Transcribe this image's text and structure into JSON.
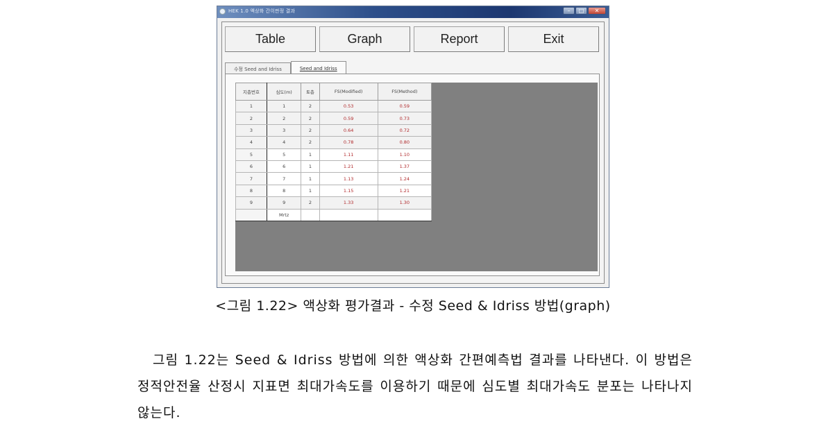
{
  "window": {
    "title": "HEK 1.0 액상화 간이판정 결과",
    "buttons": {
      "minimize": "–",
      "maximize": "□",
      "close": "✕"
    }
  },
  "toolbar": {
    "buttons": [
      "Table",
      "Graph",
      "Report",
      "Exit"
    ]
  },
  "tabs": [
    {
      "label": "수정 Seed and Idriss",
      "active": false
    },
    {
      "label": "Seed and Idriss",
      "active": true
    }
  ],
  "grid": {
    "headers": [
      "지층번호",
      "심도(m)",
      "토층",
      "FS(Modified)",
      "FS(Method)"
    ],
    "rows": [
      {
        "no": "1",
        "depth": "1",
        "soil": "2",
        "v1": "0.53",
        "v2": "0.59"
      },
      {
        "no": "2",
        "depth": "2",
        "soil": "2",
        "v1": "0.59",
        "v2": "0.73"
      },
      {
        "no": "3",
        "depth": "3",
        "soil": "2",
        "v1": "0.64",
        "v2": "0.72"
      },
      {
        "no": "4",
        "depth": "4",
        "soil": "2",
        "v1": "0.78",
        "v2": "0.80"
      },
      {
        "no": "5",
        "depth": "5",
        "soil": "1",
        "v1": "1.11",
        "v2": "1.10"
      },
      {
        "no": "6",
        "depth": "6",
        "soil": "1",
        "v1": "1.21",
        "v2": "1.37"
      },
      {
        "no": "7",
        "depth": "7",
        "soil": "1",
        "v1": "1.13",
        "v2": "1.24"
      },
      {
        "no": "8",
        "depth": "8",
        "soil": "1",
        "v1": "1.15",
        "v2": "1.21"
      },
      {
        "no": "9",
        "depth": "9",
        "soil": "2",
        "v1": "1.33",
        "v2": "1.30"
      }
    ],
    "footer": {
      "no": "",
      "depth": "Mrtz",
      "soil": "",
      "v1": "",
      "v2": ""
    }
  },
  "colors": {
    "value_red": "#b0282a",
    "pane_gray": "#808080"
  },
  "document": {
    "caption": "<그림 1.22> 액상화 평가결과 - 수정 Seed & Idriss 방법(graph)",
    "paragraph": "그림 1.22는 Seed & Idriss 방법에 의한 액상화 간편예측법 결과를 나타낸다. 이 방법은 정적안전율 산정시 지표면 최대가속도를 이용하기 때문에 심도별 최대가속도 분포는 나타나지 않는다."
  }
}
